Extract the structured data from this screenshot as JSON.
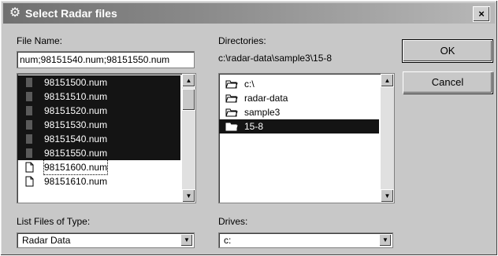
{
  "window": {
    "title": "Select Radar files",
    "close_glyph": "×",
    "icon": "radar-app-icon"
  },
  "file_name": {
    "label": "File Name:",
    "value": "num;98151540.num;98151550.num"
  },
  "files": [
    {
      "name": "98151500.num",
      "selected": true
    },
    {
      "name": "98151510.num",
      "selected": true
    },
    {
      "name": "98151520.num",
      "selected": true
    },
    {
      "name": "98151530.num",
      "selected": true
    },
    {
      "name": "98151540.num",
      "selected": true
    },
    {
      "name": "98151550.num",
      "selected": true
    },
    {
      "name": "98151600.num",
      "selected": false
    },
    {
      "name": "98151610.num",
      "selected": false
    }
  ],
  "directories": {
    "label": "Directories:",
    "path": "c:\\radar-data\\sample3\\15-8",
    "items": [
      {
        "name": "c:\\",
        "selected": false
      },
      {
        "name": "radar-data",
        "selected": false
      },
      {
        "name": "sample3",
        "selected": false
      },
      {
        "name": "15-8",
        "selected": true
      }
    ]
  },
  "buttons": {
    "ok": "OK",
    "cancel": "Cancel"
  },
  "file_type": {
    "label": "List Files of Type:",
    "value": "Radar Data"
  },
  "drives": {
    "label": "Drives:",
    "value": "c:"
  },
  "colors": {
    "selection": "#141414",
    "dialog": "#c8c8c8"
  }
}
